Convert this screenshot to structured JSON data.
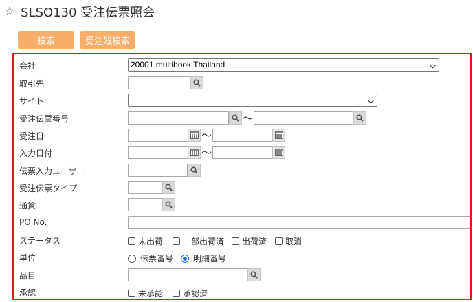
{
  "header": {
    "title": "SLSO130 受注伝票照会"
  },
  "buttons": {
    "search": "検索",
    "remaining_search": "受注残検索"
  },
  "form": {
    "company": {
      "label": "会社",
      "value": "20001 multibook Thailand"
    },
    "customer": {
      "label": "取引先"
    },
    "site": {
      "label": "サイト"
    },
    "order_no": {
      "label": "受注伝票番号"
    },
    "order_date": {
      "label": "受注日"
    },
    "entry_date": {
      "label": "入力日付"
    },
    "entry_user": {
      "label": "伝票入力ユーザー"
    },
    "order_type": {
      "label": "受注伝票タイプ"
    },
    "currency": {
      "label": "通貨"
    },
    "po_no": {
      "label": "PO No."
    },
    "status": {
      "label": "ステータス",
      "options": [
        "未出荷",
        "一部出荷済",
        "出荷済",
        "取消"
      ]
    },
    "unit": {
      "label": "単位",
      "options": [
        "伝票番号",
        "明細番号"
      ],
      "selected": "明細番号"
    },
    "item": {
      "label": "品目"
    },
    "approval": {
      "label": "承認",
      "options": [
        "未承認",
        "承認済"
      ]
    },
    "range_sep": "〜"
  }
}
